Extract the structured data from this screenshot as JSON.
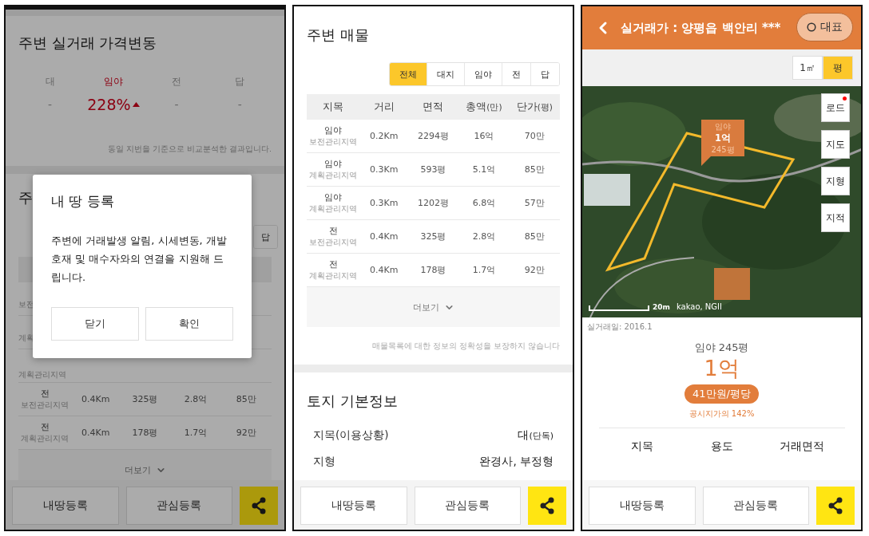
{
  "left_screen": {
    "price_change": {
      "title": "주변 실거래 가격변동",
      "columns": [
        {
          "label": "대",
          "value": "-",
          "rising": false
        },
        {
          "label": "임야",
          "value": "228%",
          "rising": true
        },
        {
          "label": "전",
          "value": "-",
          "rising": false
        },
        {
          "label": "답",
          "value": "-",
          "rising": false
        }
      ],
      "note": "동일 지번을 기준으로 비교분석한 결과입니다."
    },
    "listings": {
      "title": "주",
      "filter_tabs": [
        {
          "label": "답",
          "selected": false
        }
      ],
      "rows": [
        {
          "zone": "보전"
        },
        {
          "zone": "계획"
        },
        {
          "zone": "계획관리지역"
        },
        {
          "type": "전",
          "zone": "보전관리지역",
          "distance": "0.4Km",
          "area": "325평",
          "total": "2.8억",
          "unit_price": "85만"
        },
        {
          "type": "전",
          "zone": "계획관리지역",
          "distance": "0.4Km",
          "area": "178평",
          "total": "1.7억",
          "unit_price": "92만"
        }
      ],
      "more": "더보기"
    },
    "dialog": {
      "title": "내 땅 등록",
      "message": "주변에 거래발생 알림, 시세변동, 개발호재 및 매수자와의 연결을 지원해 드립니다.",
      "buttons": [
        "닫기",
        "확인"
      ]
    },
    "bottom_bar": {
      "buttons": [
        "내땅등록",
        "관심등록"
      ]
    }
  },
  "middle_screen": {
    "listings": {
      "title": "주변 매물",
      "filter_tabs": [
        {
          "label": "전체",
          "selected": true
        },
        {
          "label": "대지",
          "selected": false
        },
        {
          "label": "임야",
          "selected": false
        },
        {
          "label": "전",
          "selected": false
        },
        {
          "label": "답",
          "selected": false
        }
      ],
      "columns": [
        {
          "label": "지목"
        },
        {
          "label": "거리"
        },
        {
          "label": "면적"
        },
        {
          "label": "총액",
          "unit": "(만)"
        },
        {
          "label": "단가",
          "unit": "(평)"
        }
      ],
      "rows": [
        {
          "type": "임야",
          "zone": "보전관리지역",
          "distance": "0.2Km",
          "area": "2294평",
          "total": "16억",
          "unit_price": "70만"
        },
        {
          "type": "임야",
          "zone": "계획관리지역",
          "distance": "0.3Km",
          "area": "593평",
          "total": "5.1억",
          "unit_price": "85만"
        },
        {
          "type": "임야",
          "zone": "계획관리지역",
          "distance": "0.3Km",
          "area": "1202평",
          "total": "6.8억",
          "unit_price": "57만"
        },
        {
          "type": "전",
          "zone": "보전관리지역",
          "distance": "0.4Km",
          "area": "325평",
          "total": "2.8억",
          "unit_price": "85만"
        },
        {
          "type": "전",
          "zone": "계획관리지역",
          "distance": "0.4Km",
          "area": "178평",
          "total": "1.7억",
          "unit_price": "92만"
        }
      ],
      "more": "더보기",
      "disclaimer": "매물목록에 대한 정보의 정확성을 보장하지 않습니다"
    },
    "land_info": {
      "title": "토지 기본정보",
      "rows": [
        {
          "label": "지목(이용상황)",
          "value": "대",
          "note": "(단독)"
        },
        {
          "label": "지형",
          "value": "완경사, 부정형"
        }
      ]
    },
    "bottom_bar": {
      "buttons": [
        "내땅등록",
        "관심등록"
      ]
    }
  },
  "right_screen": {
    "header": {
      "title": "실거래가 : 양평읍 백안리 ***",
      "pin_button": "대표"
    },
    "unit_toggle": [
      {
        "label": "1㎡",
        "selected": false
      },
      {
        "label": "평",
        "selected": true
      }
    ],
    "map": {
      "marker": {
        "type": "임야",
        "price": "1억",
        "area": "245평"
      },
      "layer_buttons": [
        {
          "label": "로드",
          "badge": true
        },
        {
          "label": "지도",
          "badge": false
        },
        {
          "label": "지형",
          "badge": false
        },
        {
          "label": "지적",
          "badge": false
        }
      ],
      "scale": "20m",
      "attribution": "kakao, NGII"
    },
    "deal": {
      "date": "실거래일: 2016.1",
      "summary": "임야 245평",
      "price": "1억",
      "unit_price": "41만원/평당",
      "ratio": "공시지가의 142%",
      "columns": [
        "지목",
        "용도",
        "거래면적"
      ]
    },
    "bottom_bar": {
      "buttons": [
        "내땅등록",
        "관심등록"
      ]
    }
  }
}
